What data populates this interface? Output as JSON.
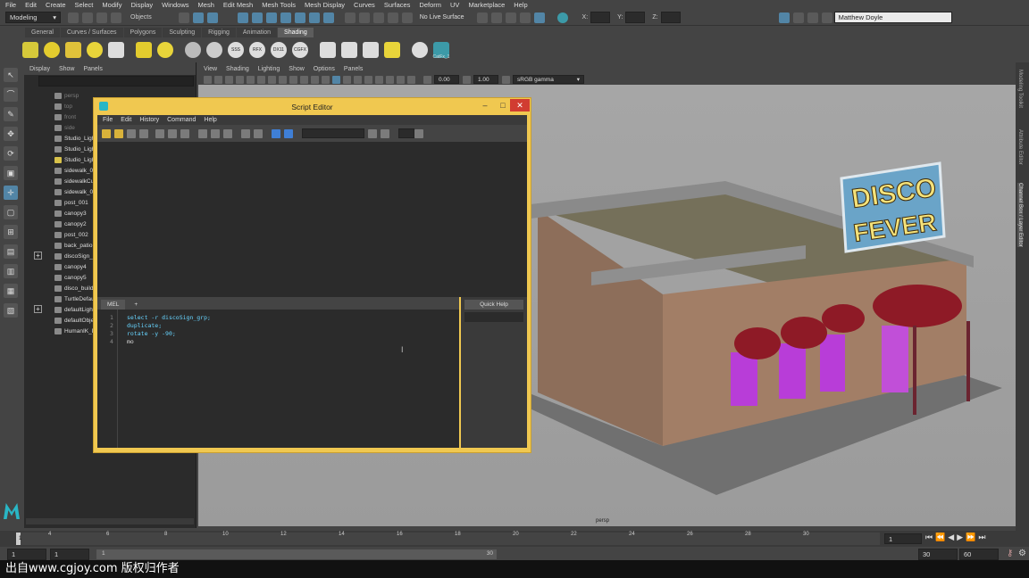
{
  "menubar": {
    "items": [
      "File",
      "Edit",
      "Create",
      "Select",
      "Modify",
      "Display",
      "Windows",
      "Mesh",
      "Edit Mesh",
      "Mesh Tools",
      "Mesh Display",
      "Curves",
      "Surfaces",
      "Deform",
      "UV",
      "Marketplace",
      "Help"
    ]
  },
  "status": {
    "mode": "Modeling",
    "objects_label": "Objects",
    "live_surface": "No Live Surface",
    "x_label": "X:",
    "y_label": "Y:",
    "z_label": "Z:",
    "user": "Matthew Doyle"
  },
  "shelf": {
    "tabs": [
      "General",
      "Curves / Surfaces",
      "Polygons",
      "Sculpting",
      "Rigging",
      "Animation",
      "Shading"
    ],
    "active": "Shading",
    "icons": [
      "SSS",
      "RFX",
      "DX11",
      "CGFX"
    ],
    "catfx_label": "CatFx_1"
  },
  "outliner": {
    "menu": [
      "Display",
      "Show",
      "Panels"
    ],
    "items": [
      "persp",
      "top",
      "front",
      "side",
      "Studio_Light",
      "Studio_Light",
      "Studio_Light",
      "sidewalk_00",
      "sidewalkCur",
      "sidewalk_00",
      "post_001",
      "canopy3",
      "canopy2",
      "post_002",
      "back_patio",
      "discoSign_g",
      "canopy4",
      "canopy5",
      "disco_buildi",
      "TurtleDefaul",
      "defaultLight",
      "defaultObje",
      "HumanIK_De"
    ]
  },
  "viewport": {
    "menu": [
      "View",
      "Shading",
      "Lighting",
      "Show",
      "Options",
      "Panels"
    ],
    "val1": "0.00",
    "val2": "1.00",
    "colorspace": "sRGB gamma",
    "camera_label": "persp",
    "sign_line1": "DISCO",
    "sign_line2": "FEVER"
  },
  "right_tabs": [
    "Modeling Toolkit",
    "Attribute Editor",
    "Channel Box / Layer Editor"
  ],
  "timeline": {
    "ticks": [
      "1",
      "2",
      "4",
      "6",
      "8",
      "10",
      "12",
      "14",
      "16",
      "18",
      "20",
      "22",
      "24",
      "26",
      "28",
      "30"
    ],
    "current": "1"
  },
  "range": {
    "start": "1",
    "inner_start": "1",
    "inner_end": "30",
    "end1": "30",
    "end2": "60"
  },
  "script_editor": {
    "title": "Script Editor",
    "menu": [
      "File",
      "Edit",
      "History",
      "Command",
      "Help"
    ],
    "tabs": [
      "MEL",
      "+"
    ],
    "quick_help": "Quick Help",
    "lines": [
      "select -r discoSign_grp;",
      "duplicate;",
      "rotate -y -90;",
      "mo"
    ],
    "line_numbers": [
      "1",
      "2",
      "3",
      "4"
    ]
  },
  "watermark": "出自www.cgjoy.com 版权归作者"
}
